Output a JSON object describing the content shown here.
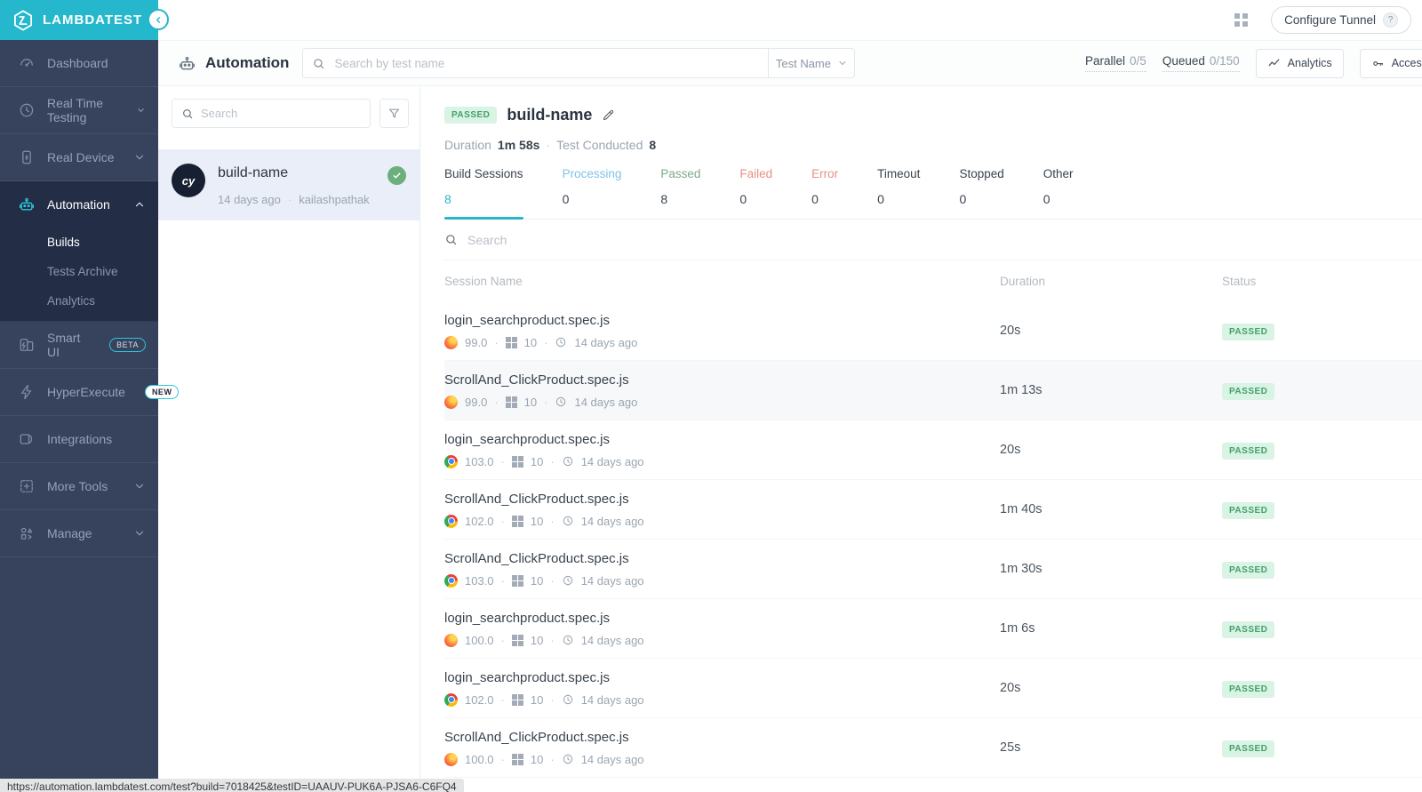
{
  "colors": {
    "brand_teal": "#25b7cb",
    "sidebar_bg": "#37425d",
    "sidebar_active_bg": "#232d45",
    "active_tab_underline": "#2ab5c9",
    "passed_badge_bg": "#d9f3e5",
    "passed_badge_text": "#45a06b",
    "tab_processing": "#7dc4e8",
    "tab_passed": "#7cab8a",
    "tab_failed": "#e79082",
    "selected_build_bg": "#e9eef8",
    "check_green": "#6cae7c"
  },
  "sidebar": {
    "logo_text": "LAMBDATEST",
    "dashboard": "Dashboard",
    "real_time_testing": "Real Time Testing",
    "real_device": "Real Device",
    "automation": "Automation",
    "builds": "Builds",
    "tests_archive": "Tests Archive",
    "analytics": "Analytics",
    "smart_ui": "Smart UI",
    "smart_ui_badge": "BETA",
    "hyperexecute": "HyperExecute",
    "hyperexecute_badge": "NEW",
    "integrations": "Integrations",
    "more_tools": "More Tools",
    "manage": "Manage"
  },
  "topbar": {
    "configure_tunnel_label": "Configure Tunnel",
    "help_label": "?"
  },
  "header": {
    "title": "Automation",
    "search_placeholder": "Search by test name",
    "filter_selected": "Test Name",
    "parallel_label": "Parallel",
    "parallel_value": "0/5",
    "queued_label": "Queued",
    "queued_value": "0/150",
    "analytics_label": "Analytics",
    "access_label": "Access Key"
  },
  "builds_panel": {
    "search_placeholder": "Search",
    "build": {
      "avatar": "cy",
      "name": "build-name",
      "age": "14 days ago",
      "owner": "kailashpathak"
    }
  },
  "main": {
    "status": "PASSED",
    "build_name": "build-name",
    "duration_label": "Duration",
    "duration_value": "1m 58s",
    "conducted_label": "Test Conducted",
    "conducted_value": "8",
    "tabs": [
      {
        "label": "Build Sessions",
        "count": "8"
      },
      {
        "label": "Processing",
        "count": "0"
      },
      {
        "label": "Passed",
        "count": "8"
      },
      {
        "label": "Failed",
        "count": "0"
      },
      {
        "label": "Error",
        "count": "0"
      },
      {
        "label": "Timeout",
        "count": "0"
      },
      {
        "label": "Stopped",
        "count": "0"
      },
      {
        "label": "Other",
        "count": "0"
      }
    ],
    "sessions_search_placeholder": "Search",
    "columns": {
      "name": "Session Name",
      "duration": "Duration",
      "status": "Status"
    },
    "rows": [
      {
        "name": "login_searchproduct.spec.js",
        "browser": "firefox",
        "version": "99.0",
        "os": "10",
        "age": "14 days ago",
        "duration": "20s",
        "status": "PASSED"
      },
      {
        "name": "ScrollAnd_ClickProduct.spec.js",
        "browser": "firefox",
        "version": "99.0",
        "os": "10",
        "age": "14 days ago",
        "duration": "1m 13s",
        "status": "PASSED"
      },
      {
        "name": "login_searchproduct.spec.js",
        "browser": "chrome",
        "version": "103.0",
        "os": "10",
        "age": "14 days ago",
        "duration": "20s",
        "status": "PASSED"
      },
      {
        "name": "ScrollAnd_ClickProduct.spec.js",
        "browser": "chrome",
        "version": "102.0",
        "os": "10",
        "age": "14 days ago",
        "duration": "1m 40s",
        "status": "PASSED"
      },
      {
        "name": "ScrollAnd_ClickProduct.spec.js",
        "browser": "chrome",
        "version": "103.0",
        "os": "10",
        "age": "14 days ago",
        "duration": "1m 30s",
        "status": "PASSED"
      },
      {
        "name": "login_searchproduct.spec.js",
        "browser": "firefox",
        "version": "100.0",
        "os": "10",
        "age": "14 days ago",
        "duration": "1m 6s",
        "status": "PASSED"
      },
      {
        "name": "login_searchproduct.spec.js",
        "browser": "chrome",
        "version": "102.0",
        "os": "10",
        "age": "14 days ago",
        "duration": "20s",
        "status": "PASSED"
      },
      {
        "name": "ScrollAnd_ClickProduct.spec.js",
        "browser": "firefox",
        "version": "100.0",
        "os": "10",
        "age": "14 days ago",
        "duration": "25s",
        "status": "PASSED"
      }
    ]
  },
  "statusbar": {
    "url": "https://automation.lambdatest.com/test?build=7018425&testID=UAAUV-PUK6A-PJSA6-C6FQ4"
  }
}
